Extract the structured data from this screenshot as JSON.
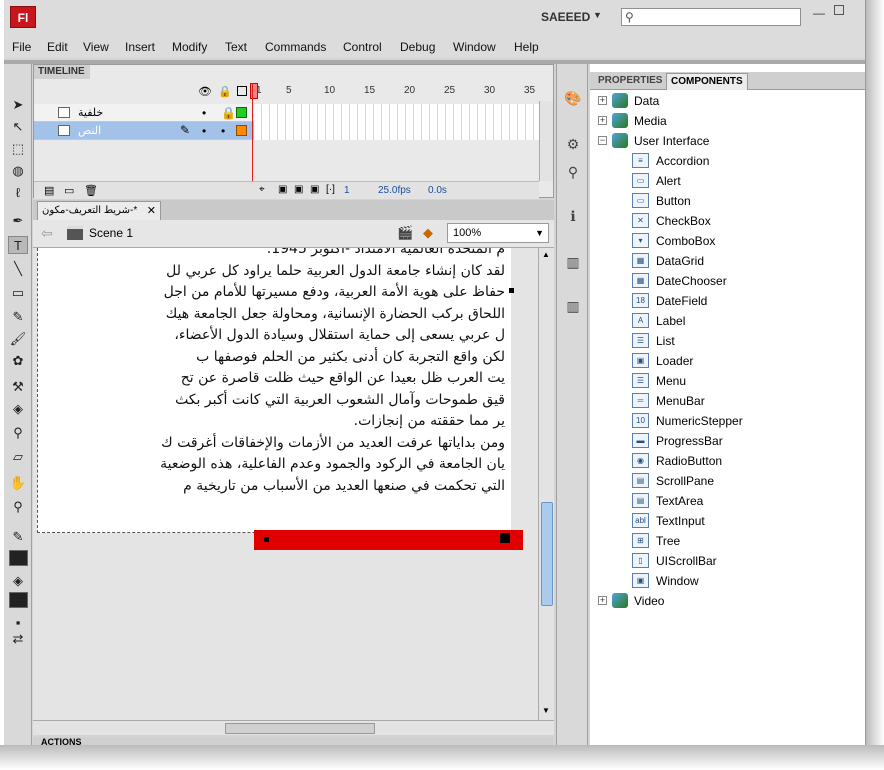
{
  "titlebar": {
    "app_icon": "Fl",
    "workspace": "SAEEED",
    "search_placeholder": ""
  },
  "menu": [
    "File",
    "Edit",
    "View",
    "Insert",
    "Modify",
    "Text",
    "Commands",
    "Control",
    "Debug",
    "Window",
    "Help"
  ],
  "timeline": {
    "tab": "TIMELINE",
    "frame_numbers": [
      "1",
      "5",
      "10",
      "15",
      "20",
      "25",
      "30",
      "35"
    ],
    "layers": [
      {
        "name": "خلفية",
        "selected": false,
        "color": "#22cc22"
      },
      {
        "name": "النص",
        "selected": true,
        "color": "#ff8a00"
      }
    ],
    "current_frame": "1",
    "fps": "25.0fps",
    "time": "0.0s"
  },
  "document": {
    "tab_title": "شريط التعريف-مكون-*",
    "scene": "Scene 1",
    "zoom": "100%"
  },
  "stage_text": {
    "lines": [
      "م المتحدة العالمية الامتداد -اكتوبر 1945.",
      "لقد كان إنشاء جامعة الدول العربية حلما يراود كل عربي لل",
      "حفاظ على هوية الأمة العربية، ودفع مسيرتها للأمام من اجل",
      "اللحاق بركب الحضارة الإنسانية، ومحاولة جعل الجامعة هيك",
      "ل عربي يسعى إلى حماية استقلال وسيادة الدول الأعضاء،",
      "لكن واقع التجربة كان أدنى بكثير من الحلم فوصفها ب",
      "يت العرب ظل بعيدا عن الواقع حيث ظلت قاصرة عن تح",
      "قيق طموحات وآمال الشعوب العربية التي كانت أكبر بكث",
      "ير مما حققته من إنجازات.",
      "ومن بداياتها عرفت العديد من الأزمات والإخفاقات أغرقت ك",
      "يان الجامعة في الركود والجمود وعدم الفاعلية، هذه الوضعية",
      "التي تحكمت في صنعها العديد من الأسباب من تاريخية م"
    ]
  },
  "bottom_panel": {
    "actions_label": "ACTIONS"
  },
  "components_panel": {
    "tabs": [
      "PROPERTIES",
      "COMPONENTS"
    ],
    "active_tab": "COMPONENTS",
    "tree": [
      {
        "label": "Data",
        "type": "folder",
        "expanded": false
      },
      {
        "label": "Media",
        "type": "folder",
        "expanded": false
      },
      {
        "label": "User Interface",
        "type": "folder",
        "expanded": true,
        "children": [
          {
            "label": "Accordion",
            "icon": "accordion-icon",
            "glyph": "≡"
          },
          {
            "label": "Alert",
            "icon": "alert-icon",
            "glyph": "▭"
          },
          {
            "label": "Button",
            "icon": "button-icon",
            "glyph": "▭"
          },
          {
            "label": "CheckBox",
            "icon": "checkbox-icon",
            "glyph": "✕"
          },
          {
            "label": "ComboBox",
            "icon": "combobox-icon",
            "glyph": "▾"
          },
          {
            "label": "DataGrid",
            "icon": "datagrid-icon",
            "glyph": "▦"
          },
          {
            "label": "DateChooser",
            "icon": "datechooser-icon",
            "glyph": "▦"
          },
          {
            "label": "DateField",
            "icon": "datefield-icon",
            "glyph": "18"
          },
          {
            "label": "Label",
            "icon": "label-icon",
            "glyph": "A"
          },
          {
            "label": "List",
            "icon": "list-icon",
            "glyph": "☰"
          },
          {
            "label": "Loader",
            "icon": "loader-icon",
            "glyph": "▣"
          },
          {
            "label": "Menu",
            "icon": "menu-icon",
            "glyph": "☰"
          },
          {
            "label": "MenuBar",
            "icon": "menubar-icon",
            "glyph": "═"
          },
          {
            "label": "NumericStepper",
            "icon": "numericstepper-icon",
            "glyph": "10"
          },
          {
            "label": "ProgressBar",
            "icon": "progressbar-icon",
            "glyph": "▬"
          },
          {
            "label": "RadioButton",
            "icon": "radiobutton-icon",
            "glyph": "◉"
          },
          {
            "label": "ScrollPane",
            "icon": "scrollpane-icon",
            "glyph": "▤"
          },
          {
            "label": "TextArea",
            "icon": "textarea-icon",
            "glyph": "▤"
          },
          {
            "label": "TextInput",
            "icon": "textinput-icon",
            "glyph": "abl"
          },
          {
            "label": "Tree",
            "icon": "tree-icon",
            "glyph": "⊞"
          },
          {
            "label": "UIScrollBar",
            "icon": "uiscrollbar-icon",
            "glyph": "▯"
          },
          {
            "label": "Window",
            "icon": "window-icon",
            "glyph": "▣"
          }
        ]
      },
      {
        "label": "Video",
        "type": "folder",
        "expanded": false
      }
    ]
  },
  "colors": {
    "accent": "#c8161d",
    "selection": "#a3c2ea",
    "redbar": "#e00000"
  }
}
